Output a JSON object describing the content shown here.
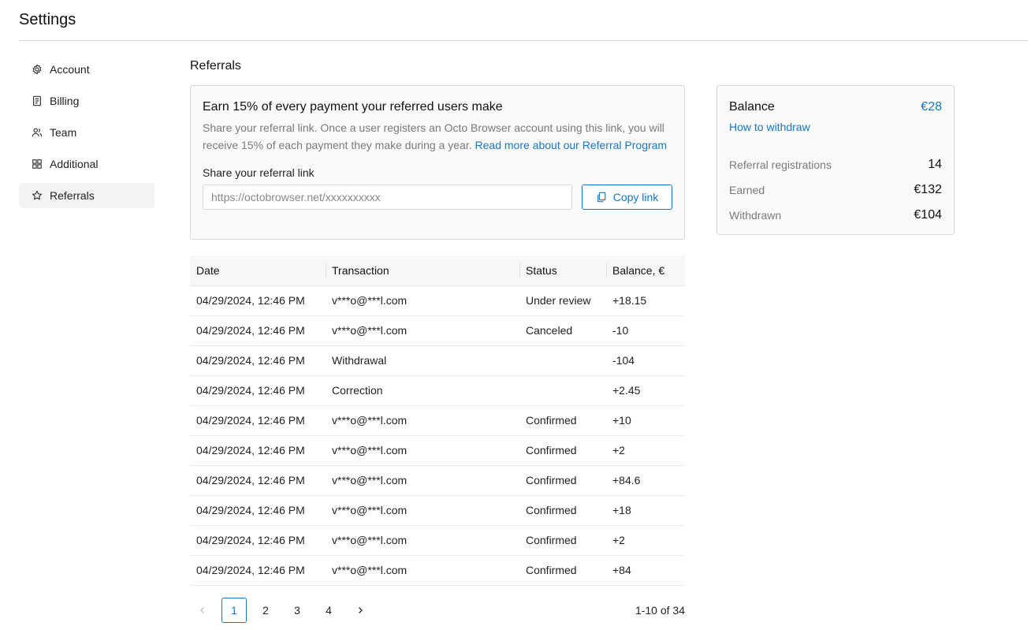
{
  "header": {
    "title": "Settings"
  },
  "sidebar": {
    "items": [
      {
        "label": "Account",
        "icon": "gear-icon"
      },
      {
        "label": "Billing",
        "icon": "receipt-icon"
      },
      {
        "label": "Team",
        "icon": "team-icon"
      },
      {
        "label": "Additional",
        "icon": "grid-icon"
      },
      {
        "label": "Referrals",
        "icon": "star-icon",
        "active": true
      }
    ]
  },
  "referrals": {
    "section_title": "Referrals",
    "heading": "Earn 15% of every payment your referred users make",
    "description": "Share your referral link. Once a user registers an Octo Browser account using this link, you will receive 15% of each payment they make during a year. ",
    "read_more": "Read more about our Referral Program",
    "share_label": "Share your referral link",
    "link_value": "https://octobrowser.net/xxxxxxxxxx",
    "copy_label": "Copy link"
  },
  "balance": {
    "title": "Balance",
    "amount": "€28",
    "withdraw_link": "How to withdraw",
    "stats": [
      {
        "label": "Referral registrations",
        "value": "14"
      },
      {
        "label": "Earned",
        "value": "€132"
      },
      {
        "label": "Withdrawn",
        "value": "€104"
      }
    ]
  },
  "table": {
    "headers": [
      "Date",
      "Transaction",
      "Status",
      "Balance, €"
    ],
    "rows": [
      [
        "04/29/2024, 12:46 PM",
        "v***o@***l.com",
        "Under review",
        "+18.15"
      ],
      [
        "04/29/2024, 12:46 PM",
        "v***o@***l.com",
        "Canceled",
        "-10"
      ],
      [
        "04/29/2024, 12:46 PM",
        "Withdrawal",
        "",
        "-104"
      ],
      [
        "04/29/2024, 12:46 PM",
        "Correction",
        "",
        "+2.45"
      ],
      [
        "04/29/2024, 12:46 PM",
        "v***o@***l.com",
        "Confirmed",
        "+10"
      ],
      [
        "04/29/2024, 12:46 PM",
        "v***o@***l.com",
        "Confirmed",
        "+2"
      ],
      [
        "04/29/2024, 12:46 PM",
        "v***o@***l.com",
        "Confirmed",
        "+84.6"
      ],
      [
        "04/29/2024, 12:46 PM",
        "v***o@***l.com",
        "Confirmed",
        "+18"
      ],
      [
        "04/29/2024, 12:46 PM",
        "v***o@***l.com",
        "Confirmed",
        "+2"
      ],
      [
        "04/29/2024, 12:46 PM",
        "v***o@***l.com",
        "Confirmed",
        "+84"
      ]
    ]
  },
  "pagination": {
    "pages": [
      "1",
      "2",
      "3",
      "4"
    ],
    "current": "1",
    "info": "1-10 of 34"
  },
  "colors": {
    "accent": "#1677c9",
    "muted_text": "#7a7a7a",
    "border": "#d9d9d9"
  }
}
